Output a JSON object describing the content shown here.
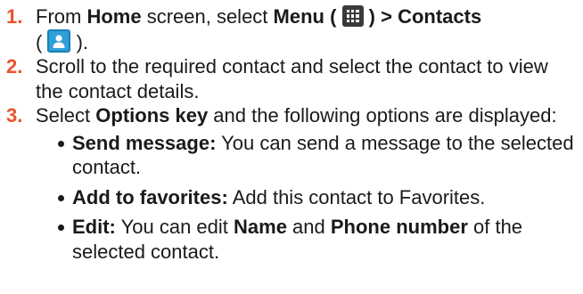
{
  "step1": {
    "num": "1.",
    "t1": "From ",
    "home": "Home",
    "t2": " screen, select ",
    "menu": "Menu",
    "t3": " ( ",
    "t4": " ) > ",
    "contacts": "Contacts",
    "t5": "( ",
    "t6": " )."
  },
  "step2": {
    "num": "2.",
    "text": "Scroll to the required contact and select the contact to view the contact details."
  },
  "step3": {
    "num": "3.",
    "t1": "Select ",
    "options_key": "Options key",
    "t2": " and the following options are displayed:"
  },
  "options": [
    {
      "label": "Send message:",
      "text": "  You can send a message to the selected contact."
    },
    {
      "label": "Add to favorites:",
      "text": " Add this contact to Favorites."
    },
    {
      "label": "Edit:",
      "t1": " You can edit ",
      "name": "Name",
      "t2": " and ",
      "phone": "Phone number",
      "t3": " of the selected contact."
    }
  ],
  "icons": {
    "menu": "menu-grid-icon",
    "contacts": "contacts-person-icon"
  },
  "colors": {
    "step_number": "#e8532a",
    "contacts_icon": "#2f9fd8",
    "menu_icon": "#3a3a3a"
  }
}
